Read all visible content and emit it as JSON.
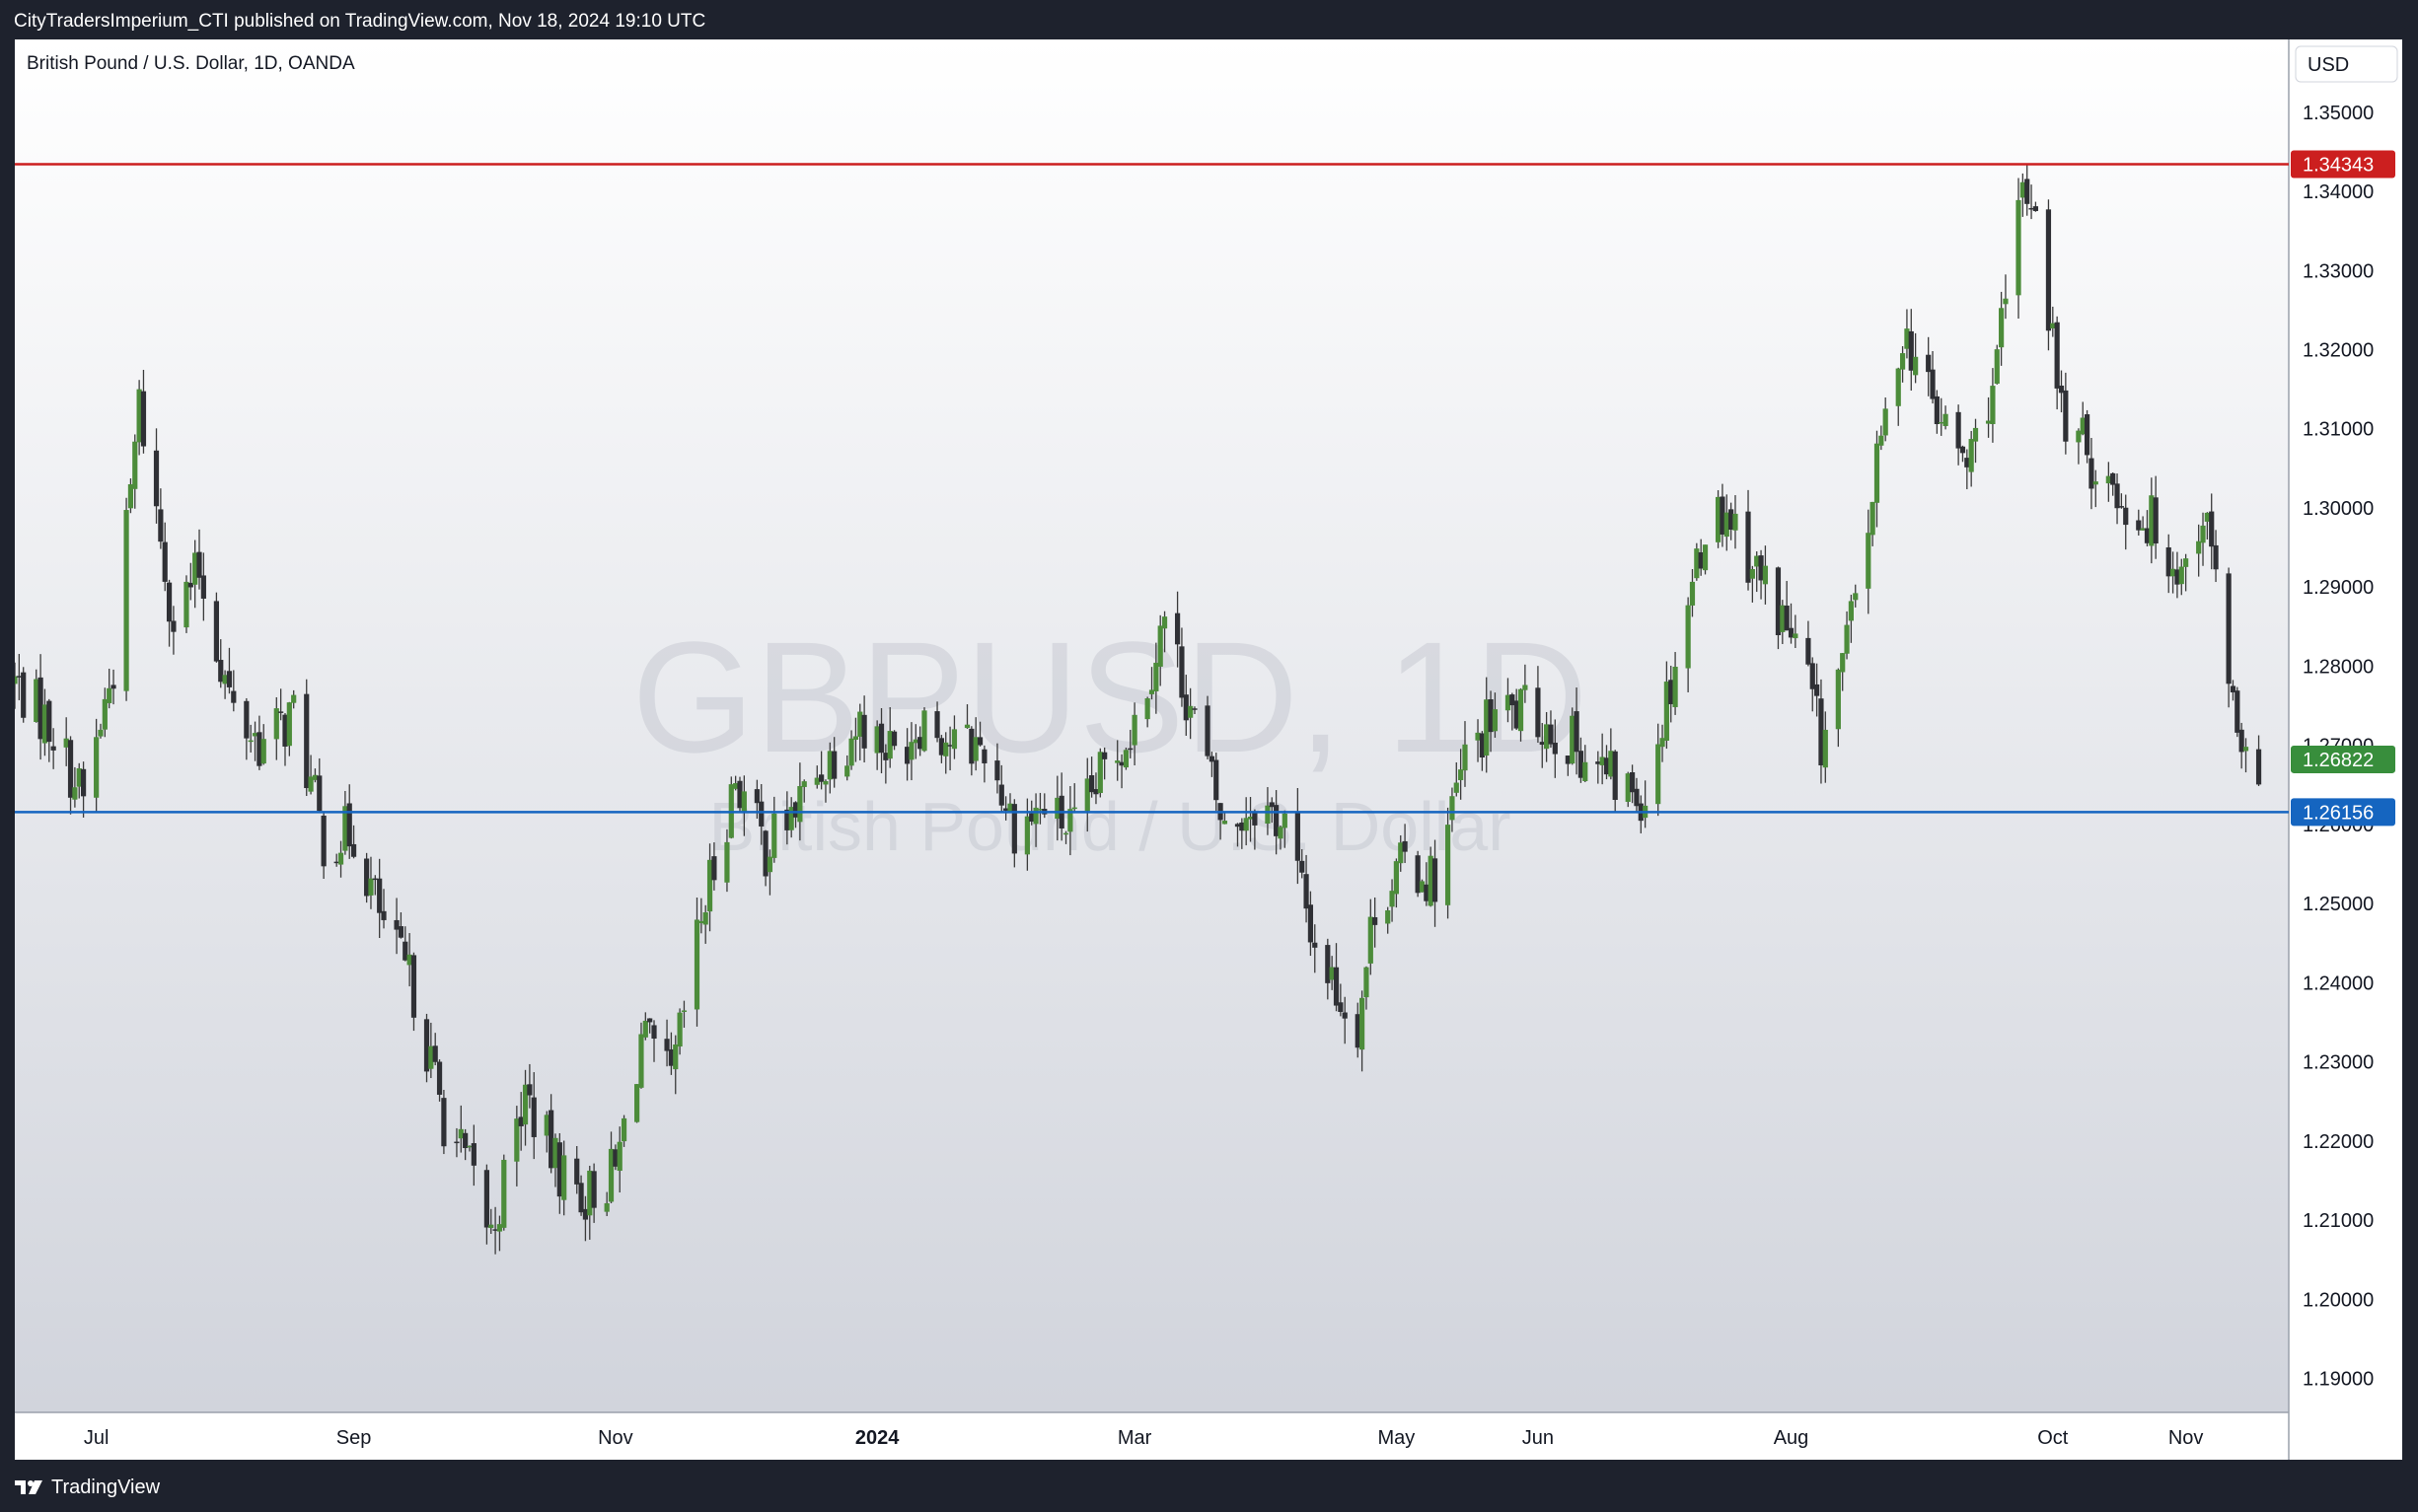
{
  "header": {
    "publisher_line": "CityTradersImperium_CTI published on TradingView.com, Nov 18, 2024 19:10 UTC"
  },
  "footer": {
    "brand": "TradingView",
    "logo_icon": "tradingview-logo-icon"
  },
  "chart_data": {
    "type": "candlestick",
    "title": "British Pound / U.S. Dollar, 1D, OANDA",
    "watermark_symbol": "GBPUSD, 1D",
    "watermark_name": "British Pound / U.S. Dollar",
    "currency": "USD",
    "ylim": [
      1.1857,
      1.3592
    ],
    "y_ticks": [
      "1.35000",
      "1.34000",
      "1.33000",
      "1.32000",
      "1.31000",
      "1.30000",
      "1.29000",
      "1.28000",
      "1.27000",
      "1.26000",
      "1.25000",
      "1.24000",
      "1.23000",
      "1.22000",
      "1.21000",
      "1.20000",
      "1.19000"
    ],
    "x_ticks": [
      {
        "label": "Jul",
        "date": "2023-07-03",
        "bold": false
      },
      {
        "label": "Sep",
        "date": "2023-09-01",
        "bold": false
      },
      {
        "label": "Nov",
        "date": "2023-11-01",
        "bold": false
      },
      {
        "label": "2024",
        "date": "2024-01-01",
        "bold": true
      },
      {
        "label": "Mar",
        "date": "2024-03-01",
        "bold": false
      },
      {
        "label": "May",
        "date": "2024-05-01",
        "bold": false
      },
      {
        "label": "Jun",
        "date": "2024-06-03",
        "bold": false
      },
      {
        "label": "Aug",
        "date": "2024-08-01",
        "bold": false
      },
      {
        "label": "Oct",
        "date": "2024-10-01",
        "bold": false
      },
      {
        "label": "Nov",
        "date": "2024-11-01",
        "bold": false
      }
    ],
    "x_range": [
      "2023-06-14",
      "2024-11-25"
    ],
    "horizontal_lines": [
      {
        "value": 1.34343,
        "label": "1.34343",
        "color": "#cc1f1f"
      },
      {
        "value": 1.26156,
        "label": "1.26156",
        "color": "#1565c0"
      }
    ],
    "last_price": {
      "value": 1.26822,
      "label": "1.26822",
      "color": "#388e3c"
    },
    "colors": {
      "up": "#4c8c3a",
      "down": "#2f3035",
      "wick": "#3a3a3a"
    },
    "approx_close_path": [
      {
        "date": "2023-06-14",
        "close": 1.278
      },
      {
        "date": "2023-06-23",
        "close": 1.272
      },
      {
        "date": "2023-06-30",
        "close": 1.263
      },
      {
        "date": "2023-07-07",
        "close": 1.28
      },
      {
        "date": "2023-07-13",
        "close": 1.313
      },
      {
        "date": "2023-07-21",
        "close": 1.286
      },
      {
        "date": "2023-07-27",
        "close": 1.292
      },
      {
        "date": "2023-08-04",
        "close": 1.274
      },
      {
        "date": "2023-08-11",
        "close": 1.27
      },
      {
        "date": "2023-08-18",
        "close": 1.274
      },
      {
        "date": "2023-08-25",
        "close": 1.258
      },
      {
        "date": "2023-09-01",
        "close": 1.259
      },
      {
        "date": "2023-09-08",
        "close": 1.247
      },
      {
        "date": "2023-09-15",
        "close": 1.239
      },
      {
        "date": "2023-09-22",
        "close": 1.223
      },
      {
        "date": "2023-09-29",
        "close": 1.215
      },
      {
        "date": "2023-10-03",
        "close": 1.208
      },
      {
        "date": "2023-10-11",
        "close": 1.226
      },
      {
        "date": "2023-10-18",
        "close": 1.217
      },
      {
        "date": "2023-10-25",
        "close": 1.213
      },
      {
        "date": "2023-11-01",
        "close": 1.216
      },
      {
        "date": "2023-11-07",
        "close": 1.233
      },
      {
        "date": "2023-11-14",
        "close": 1.227
      },
      {
        "date": "2023-11-21",
        "close": 1.248
      },
      {
        "date": "2023-11-29",
        "close": 1.266
      },
      {
        "date": "2023-12-06",
        "close": 1.257
      },
      {
        "date": "2023-12-13",
        "close": 1.262
      },
      {
        "date": "2023-12-20",
        "close": 1.268
      },
      {
        "date": "2023-12-28",
        "close": 1.273
      },
      {
        "date": "2024-01-05",
        "close": 1.269
      },
      {
        "date": "2024-01-12",
        "close": 1.274
      },
      {
        "date": "2024-01-19",
        "close": 1.27
      },
      {
        "date": "2024-01-26",
        "close": 1.27
      },
      {
        "date": "2024-02-02",
        "close": 1.26
      },
      {
        "date": "2024-02-09",
        "close": 1.262
      },
      {
        "date": "2024-02-16",
        "close": 1.259
      },
      {
        "date": "2024-02-23",
        "close": 1.267
      },
      {
        "date": "2024-03-01",
        "close": 1.273
      },
      {
        "date": "2024-03-08",
        "close": 1.286
      },
      {
        "date": "2024-03-15",
        "close": 1.273
      },
      {
        "date": "2024-03-22",
        "close": 1.259
      },
      {
        "date": "2024-03-29",
        "close": 1.263
      },
      {
        "date": "2024-04-05",
        "close": 1.26
      },
      {
        "date": "2024-04-12",
        "close": 1.245
      },
      {
        "date": "2024-04-19",
        "close": 1.237
      },
      {
        "date": "2024-04-22",
        "close": 1.235
      },
      {
        "date": "2024-04-26",
        "close": 1.25
      },
      {
        "date": "2024-05-03",
        "close": 1.255
      },
      {
        "date": "2024-05-10",
        "close": 1.253
      },
      {
        "date": "2024-05-17",
        "close": 1.268
      },
      {
        "date": "2024-05-24",
        "close": 1.274
      },
      {
        "date": "2024-05-31",
        "close": 1.274
      },
      {
        "date": "2024-06-07",
        "close": 1.272
      },
      {
        "date": "2024-06-14",
        "close": 1.269
      },
      {
        "date": "2024-06-21",
        "close": 1.265
      },
      {
        "date": "2024-06-28",
        "close": 1.264
      },
      {
        "date": "2024-07-05",
        "close": 1.281
      },
      {
        "date": "2024-07-12",
        "close": 1.298
      },
      {
        "date": "2024-07-17",
        "close": 1.3
      },
      {
        "date": "2024-07-24",
        "close": 1.292
      },
      {
        "date": "2024-07-31",
        "close": 1.285
      },
      {
        "date": "2024-08-05",
        "close": 1.278
      },
      {
        "date": "2024-08-08",
        "close": 1.27
      },
      {
        "date": "2024-08-15",
        "close": 1.285
      },
      {
        "date": "2024-08-21",
        "close": 1.305
      },
      {
        "date": "2024-08-27",
        "close": 1.323
      },
      {
        "date": "2024-09-03",
        "close": 1.313
      },
      {
        "date": "2024-09-11",
        "close": 1.305
      },
      {
        "date": "2024-09-18",
        "close": 1.318
      },
      {
        "date": "2024-09-24",
        "close": 1.34
      },
      {
        "date": "2024-09-27",
        "close": 1.339
      },
      {
        "date": "2024-10-03",
        "close": 1.312
      },
      {
        "date": "2024-10-10",
        "close": 1.306
      },
      {
        "date": "2024-10-17",
        "close": 1.301
      },
      {
        "date": "2024-10-24",
        "close": 1.298
      },
      {
        "date": "2024-10-31",
        "close": 1.292
      },
      {
        "date": "2024-11-05",
        "close": 1.3
      },
      {
        "date": "2024-11-08",
        "close": 1.291
      },
      {
        "date": "2024-11-14",
        "close": 1.266
      },
      {
        "date": "2024-11-18",
        "close": 1.26822
      }
    ]
  }
}
